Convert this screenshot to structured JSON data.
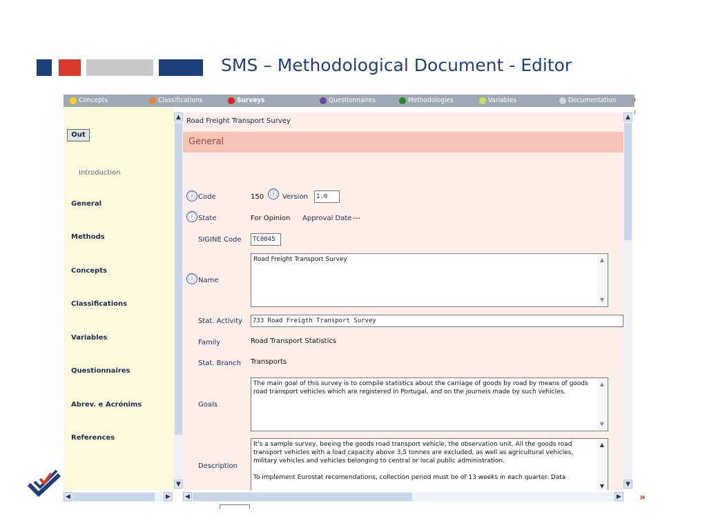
{
  "slide": {
    "title": "SMS – Methodological Document - Editor",
    "next_label": "»"
  },
  "topnav": [
    {
      "label": "Concepts",
      "color": "#ffd21a",
      "active": false
    },
    {
      "label": "Classifications",
      "color": "#e8843c",
      "active": false
    },
    {
      "label": "Surveys",
      "color": "#e02020",
      "active": true
    },
    {
      "label": "Questionnaires",
      "color": "#6a4aa0",
      "active": false
    },
    {
      "label": "Methodologies",
      "color": "#1a8a3a",
      "active": false
    },
    {
      "label": "Variables",
      "color": "#c7e25a",
      "active": false
    },
    {
      "label": "Documentation",
      "color": "#d8d8d8",
      "active": false
    }
  ],
  "sidebar": {
    "out_label": "Out",
    "intro": "Introduction",
    "items": [
      "General",
      "Methods",
      "Concepts",
      "Classifications",
      "Variables",
      "Questionnaires",
      "Abrev. e Acrónims",
      "References"
    ]
  },
  "main": {
    "doc_title": "Road Freight Transport Survey",
    "section": "General",
    "fields": {
      "code_label": "Code",
      "code_value": "150",
      "version_label": "Version",
      "version_value": "1.0",
      "state_label": "State",
      "state_value": "For Opinion",
      "approval_label": "Approval Date",
      "approval_value": "---",
      "sigine_label": "SIGINE Code",
      "sigine_value": "TC0045",
      "name_label": "Name",
      "name_value": "Road Freight Transport Survey",
      "activity_label": "Stat. Activity",
      "activity_value": "733 Road Freigth Transport Survey",
      "family_label": "Family",
      "family_value": "Road Transport Statistics",
      "branch_label": "Stat. Branch",
      "branch_value": "Transports",
      "goals_label": "Goals",
      "goals_value": "The main goal of this survey is to compile statistics about the carriage of goods by road by means of goods road transport vehicles which are registered in Portugal, and on the journeis made by such vehicles.",
      "description_label": "Description",
      "description_p1": "It's a sample survey, beeing the goods road transport vehicle, the observation unit. All the goods road transport vehicles with a load capacity above 3,5 tonnes are excluded, as well as agricultural vehicles, military vehicles and vehicles belonging to central or local public administration.",
      "description_p2": "To implement Eurostat recomendations, collection period must be of 13 weeks in each quarter. Data"
    }
  },
  "icons": {
    "info": "ⓘ",
    "scroll_up": "▲",
    "scroll_down": "▼",
    "scroll_left": "◀",
    "scroll_right": "▶"
  }
}
